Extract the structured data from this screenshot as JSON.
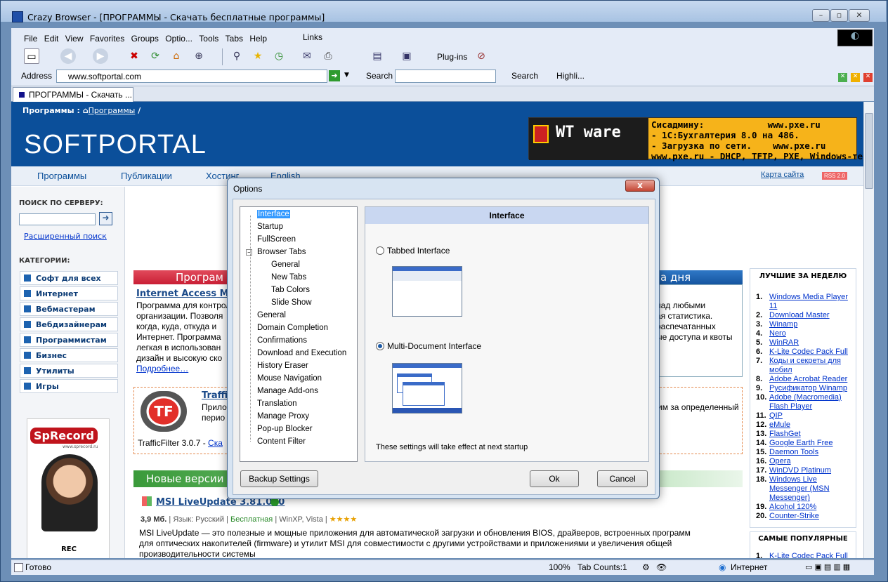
{
  "window": {
    "title": "Crazy Browser - [ПРОГРАММЫ - Скачать бесплатные программы]"
  },
  "menu": [
    "File",
    "Edit",
    "View",
    "Favorites",
    "Groups",
    "Optio...",
    "Tools",
    "Tabs",
    "Help"
  ],
  "links_label": "Links",
  "toolbar": {
    "plugins_label": "Plug-ins"
  },
  "address": {
    "label": "Address",
    "value": "www.softportal.com"
  },
  "search": {
    "label": "Search",
    "button": "Search",
    "highlight": "Highli..."
  },
  "tab": {
    "label": "ПРОГРАММЫ - Скачать ..."
  },
  "page": {
    "crumbs_label": "Программы :",
    "crumbs_link": "Программы",
    "crumbs_sep": "/",
    "logo": "SOFTPORTAL",
    "banner_logo": "WT ware",
    "banner_text": "Сисадмину:            www.pxe.ru\n- 1С:Бухгалтерия 8.0 на 486.\n- Загрузка по сети.    www.pxe.ru\nwww.pxe.ru - DHCP, TFTP, PXE, Windows-терминалы.",
    "nav": [
      "Программы",
      "Публикации",
      "Хостинг",
      "English"
    ],
    "sitemap": "Карта сайта",
    "rss": "RSS 2.0",
    "search_title": "ПОИСК ПО СЕРВЕРУ:",
    "adv_search": "Расширенный поиск",
    "categories_title": "КАТЕГОРИИ:",
    "categories": [
      "Софт для всех",
      "Интернет",
      "Вебмастерам",
      "Вебдизайнерам",
      "Программистам",
      "Бизнес",
      "Утилиты",
      "Игры"
    ],
    "sprecord": "SpRecord",
    "sprecord_site": "www.sprecord.ru",
    "rec": "REC",
    "programs_head": "Програм",
    "day_head": "а дня",
    "iam_title": "Internet Access Mo",
    "iam_text": [
      "Программа для контрол",
      "организации. Позволя",
      "когда, куда, откуда и",
      "Интернет. Программа",
      "легкая в использован",
      "дизайн и высокую ско"
    ],
    "more": "Подробнее…",
    "right_text": [
      "над любыми",
      "ая статистика.",
      "распечатанных",
      "ые доступа и квоты"
    ],
    "tf_title": "Traffi",
    "tf_text": [
      "Прило",
      "перио"
    ],
    "tf_right": "им за определенный",
    "tf_ver": "TrafficFilter 3.0.7 -",
    "tf_link": "Ска",
    "new_versions": "Новые версии",
    "msi_title": "MSI LiveUpdate 3.81.000",
    "msi_meta": [
      "3,9 Мб.",
      "Язык: Русский",
      "Бесплатная",
      "WinXP, Vista",
      "★★★★"
    ],
    "msi_desc": [
      "MSI LiveUpdate — это полезные и мощные приложения для автоматической загрузки и обновления BIOS, драйверов, встроенных программ",
      "для оптических накопителей (firmware) и утилит MSI для совместимости с другими устройствами и приложениями и увеличения общей",
      "производительности системы"
    ],
    "top_week_title": "ЛУЧШИЕ ЗА НЕДЕЛЮ",
    "top_week": [
      {
        "n": "1.",
        "t": "Windows Media Player 11"
      },
      {
        "n": "2.",
        "t": "Download Master"
      },
      {
        "n": "3.",
        "t": "Winamp"
      },
      {
        "n": "4.",
        "t": "Nero"
      },
      {
        "n": "5.",
        "t": "WinRAR"
      },
      {
        "n": "6.",
        "t": "K-Lite Codec Pack Full"
      },
      {
        "n": "7.",
        "t": "Коды и секреты для мобил"
      },
      {
        "n": "8.",
        "t": "Adobe Acrobat Reader"
      },
      {
        "n": "9.",
        "t": "Русификатор Winamp"
      },
      {
        "n": "10.",
        "t": "Adobe (Macromedia) Flash Player"
      },
      {
        "n": "11.",
        "t": "QIP"
      },
      {
        "n": "12.",
        "t": "eMule"
      },
      {
        "n": "13.",
        "t": "FlashGet"
      },
      {
        "n": "14.",
        "t": "Google Earth Free"
      },
      {
        "n": "15.",
        "t": "Daemon Tools"
      },
      {
        "n": "16.",
        "t": "Opera"
      },
      {
        "n": "17.",
        "t": "WinDVD Platinum"
      },
      {
        "n": "18.",
        "t": "Windows Live Messenger (MSN Messenger)"
      },
      {
        "n": "19.",
        "t": "Alcohol 120%"
      },
      {
        "n": "20.",
        "t": "Counter-Strike"
      }
    ],
    "popular_title": "САМЫЕ ПОПУЛЯРНЫЕ",
    "popular_first": {
      "n": "1.",
      "t": "K-Lite Codec Pack Full"
    }
  },
  "dialog": {
    "title": "Options",
    "close": "x",
    "tree": [
      {
        "t": "Interface",
        "lvl": 0,
        "sel": true
      },
      {
        "t": "Startup",
        "lvl": 0
      },
      {
        "t": "FullScreen",
        "lvl": 0
      },
      {
        "t": "Browser Tabs",
        "lvl": 0,
        "exp": true
      },
      {
        "t": "General",
        "lvl": 1
      },
      {
        "t": "New Tabs",
        "lvl": 1
      },
      {
        "t": "Tab Colors",
        "lvl": 1
      },
      {
        "t": "Slide Show",
        "lvl": 1
      },
      {
        "t": "General",
        "lvl": 0
      },
      {
        "t": "Domain Completion",
        "lvl": 0
      },
      {
        "t": "Confirmations",
        "lvl": 0
      },
      {
        "t": "Download and Execution",
        "lvl": 0
      },
      {
        "t": "History Eraser",
        "lvl": 0
      },
      {
        "t": "Mouse Navigation",
        "lvl": 0
      },
      {
        "t": "Manage Add-ons",
        "lvl": 0
      },
      {
        "t": "Translation",
        "lvl": 0
      },
      {
        "t": "Manage Proxy",
        "lvl": 0
      },
      {
        "t": "Pop-up Blocker",
        "lvl": 0
      },
      {
        "t": "Content Filter",
        "lvl": 0
      }
    ],
    "pane_title": "Interface",
    "opt_tabbed": "Tabbed Interface",
    "opt_mdi": "Multi-Document Interface",
    "selected": "Multi-Document Interface",
    "note": "These settings will take effect at next startup",
    "backup": "Backup Settings",
    "ok": "Ok",
    "cancel": "Cancel"
  },
  "status": {
    "text": "Готово",
    "zoom": "100%",
    "tabcount": "Tab Counts:1",
    "zone": "Интернет"
  }
}
